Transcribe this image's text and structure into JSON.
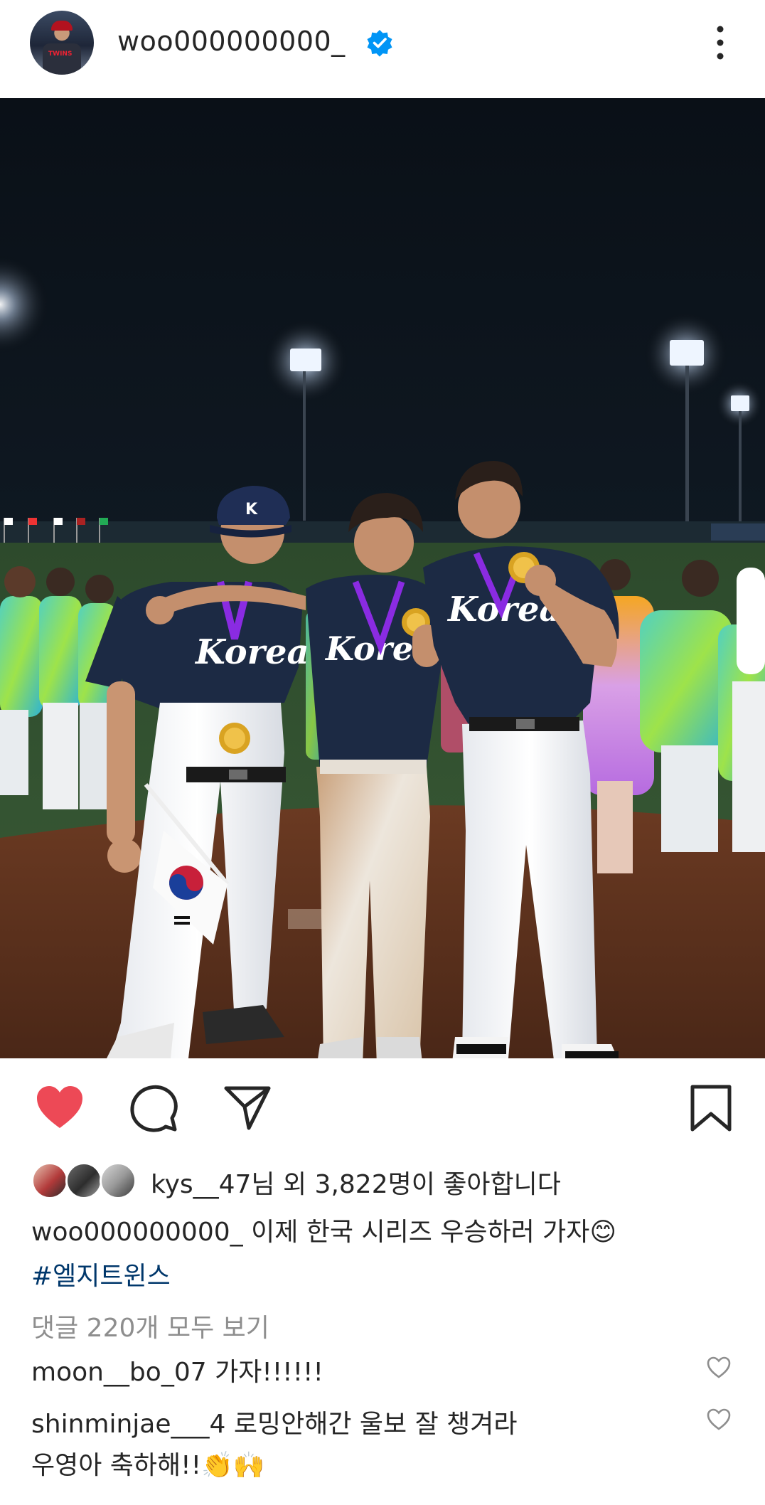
{
  "header": {
    "username": "woo000000000_",
    "more_icon": "more-vertical-icon",
    "verified_icon": "verified-badge-icon"
  },
  "photo": {
    "jersey_text": "Korea",
    "cap_letter": "K"
  },
  "actions": {
    "like_icon": "heart-filled-icon",
    "comment_icon": "comment-icon",
    "share_icon": "send-icon",
    "save_icon": "bookmark-icon",
    "like_color": "#ed4956"
  },
  "likes": {
    "text": "kys__47님 외 3,822명이 좋아합니다"
  },
  "caption": {
    "username": "woo000000000_",
    "text": "이제 한국 시리즈 우승하러 가자",
    "emoji": "😊",
    "hashtag": "#엘지트윈스"
  },
  "view_comments": "댓글 220개 모두 보기",
  "comments": [
    {
      "username": "moon__bo_07",
      "text": "가자!!!!!!"
    },
    {
      "username": "shinminjae___4",
      "text": "로밍안해간 울보 잘 챙겨라",
      "text2": "우영아 축하해!!",
      "emoji": "👏🙌"
    }
  ],
  "colors": {
    "link": "#00376b",
    "secondary_text": "#8e8e8e",
    "verified": "#0095f6"
  }
}
